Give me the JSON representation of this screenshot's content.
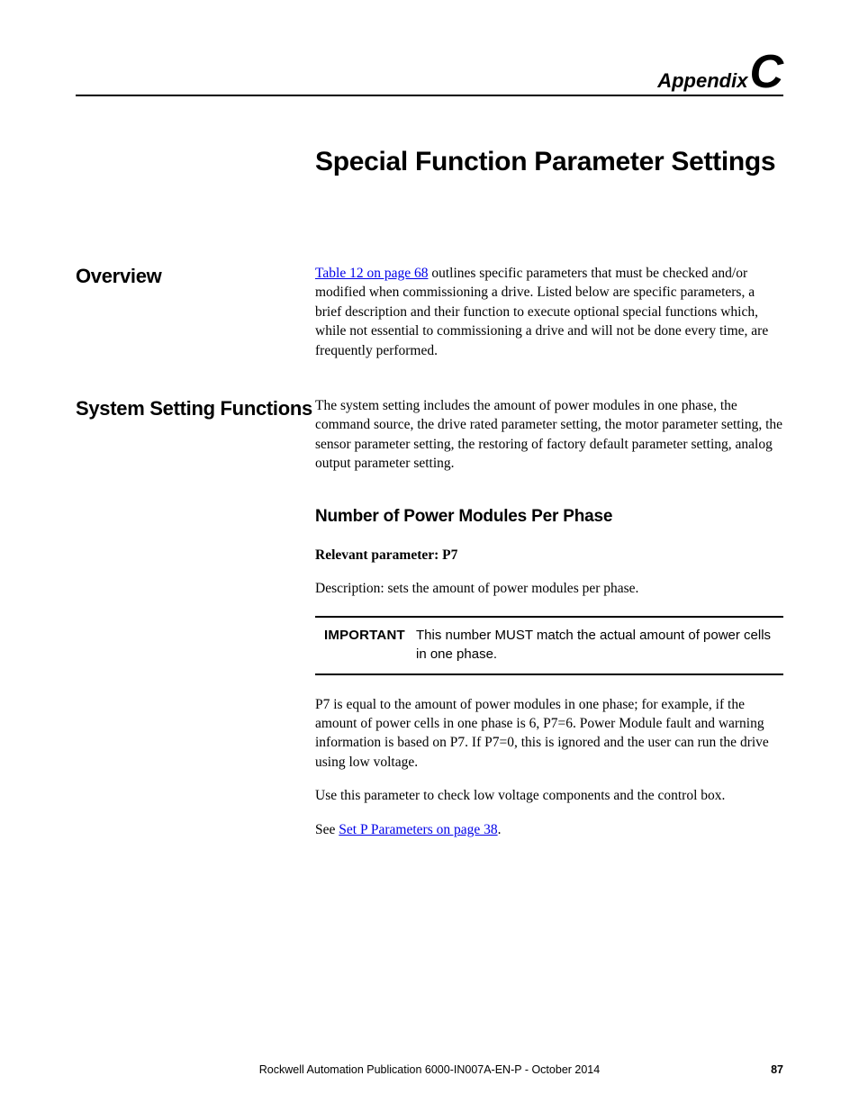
{
  "header": {
    "appendix_word": "Appendix",
    "appendix_letter": "C"
  },
  "chapter_title": "Special Function Parameter Settings",
  "section_overview": {
    "heading": "Overview",
    "link_text": "Table 12 on page 68",
    "body_after_link": " outlines specific parameters that must be checked and/or modified when commissioning a drive. Listed below are specific parameters, a brief description and their function to execute optional special functions which, while not essential to commissioning a drive and will not be done every time, are frequently performed."
  },
  "section_system": {
    "heading": "System Setting Functions",
    "intro": "The system setting includes the amount of power modules in one phase, the command source, the drive rated parameter setting, the motor parameter setting, the sensor parameter setting, the restoring of factory default parameter setting, analog output parameter setting.",
    "sub_heading": "Number of Power Modules Per Phase",
    "relevant_param": "Relevant parameter: P7",
    "description": "Description: sets the amount of power modules per phase.",
    "important_label": "IMPORTANT",
    "important_text": "This number MUST match the actual amount of power cells in one phase.",
    "p7_para": "P7 is equal to the amount of power modules in one phase; for example, if the amount of power cells in one phase is 6, P7=6. Power Module fault and warning information is based on P7. If P7=0, this is ignored and the user can run the drive using low voltage.",
    "use_para": "Use this parameter to check low voltage components and the control box.",
    "see_prefix": "See ",
    "see_link": "Set P Parameters on page 38",
    "see_suffix": "."
  },
  "footer": {
    "publication": "Rockwell Automation Publication 6000-IN007A-EN-P - October 2014",
    "page_number": "87"
  }
}
